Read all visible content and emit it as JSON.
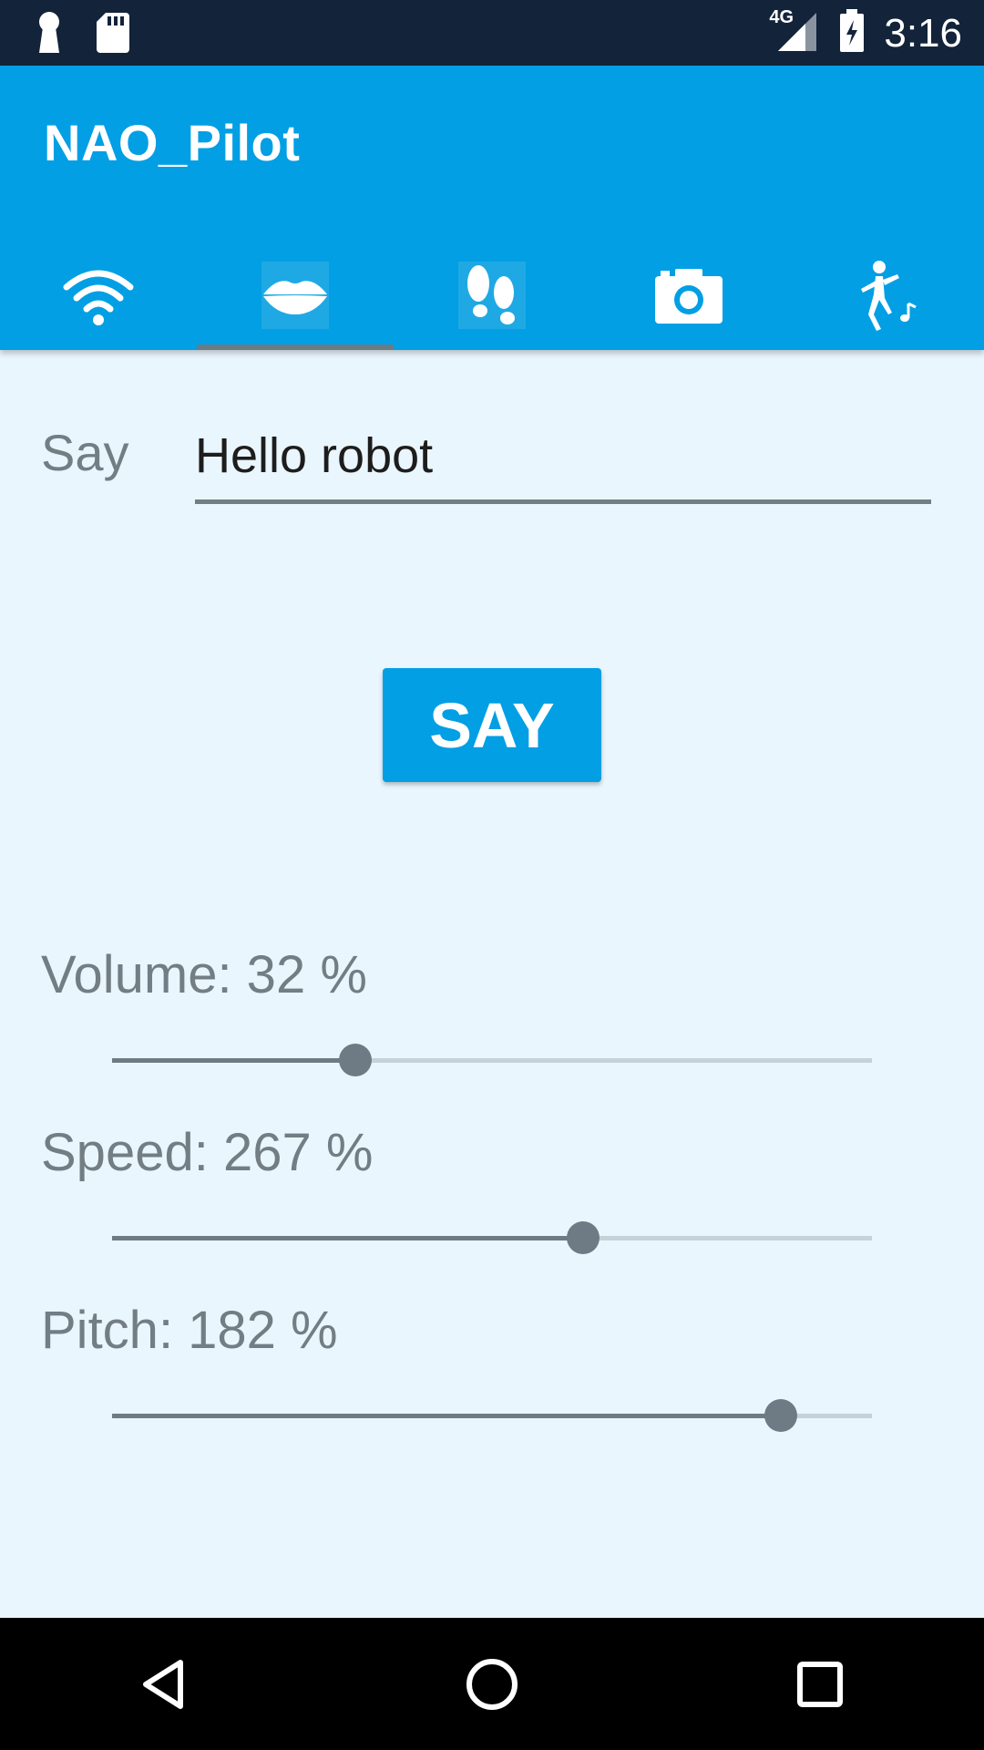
{
  "status_bar": {
    "time": "3:16",
    "network": "4G",
    "icons": [
      "keyhole-icon",
      "sd-card-icon",
      "signal-icon",
      "battery-charging-icon"
    ]
  },
  "app": {
    "title": "NAO_Pilot",
    "accent_color": "#029fe4",
    "tabs": [
      {
        "icon": "wifi-icon",
        "selected": false
      },
      {
        "icon": "lips-icon",
        "selected": true
      },
      {
        "icon": "footprints-icon",
        "selected": false
      },
      {
        "icon": "camera-icon",
        "selected": false
      },
      {
        "icon": "dance-icon",
        "selected": false
      }
    ]
  },
  "say": {
    "label": "Say",
    "input_value": "Hello robot",
    "button_label": "SAY"
  },
  "sliders": [
    {
      "label": "Volume: 32 %",
      "value_fraction": 0.32
    },
    {
      "label": "Speed: 267 %",
      "value_fraction": 0.62
    },
    {
      "label": "Pitch: 182 %",
      "value_fraction": 0.88
    }
  ],
  "nav_bar": {
    "buttons": [
      "back-icon",
      "home-icon",
      "recents-icon"
    ]
  }
}
